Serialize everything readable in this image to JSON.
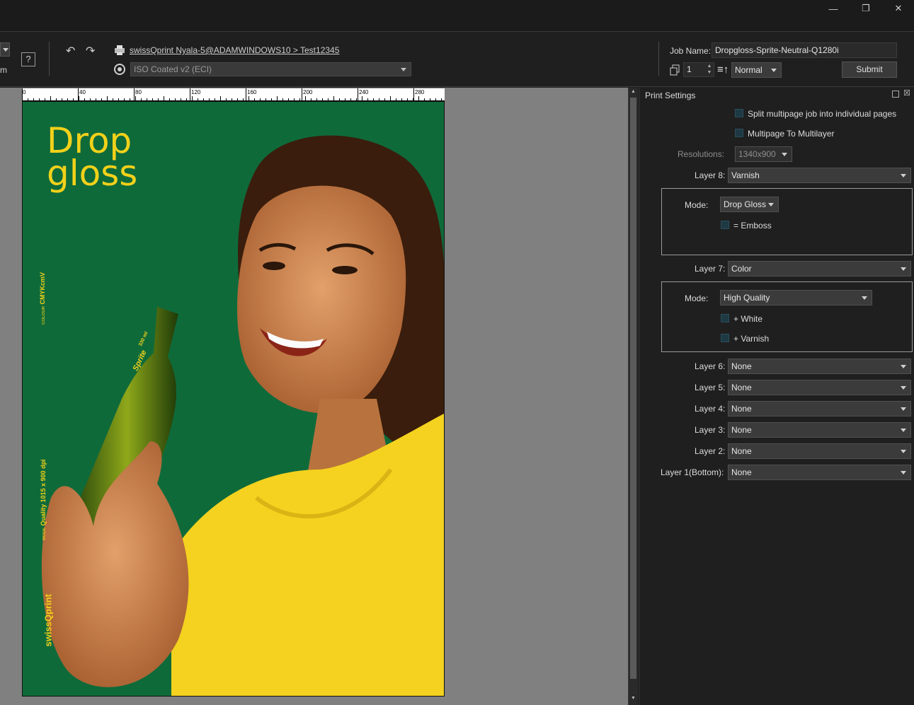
{
  "toolbar": {
    "left_text": "m",
    "printer_path": "swissQprint Nyala-5@ADAMWINDOWS10 > Test12345",
    "color_profile": "ISO Coated v2 (ECI)",
    "job_name_label": "Job Name:",
    "job_name_value": "Dropgloss-Sprite-Neutral-Q1280i",
    "copies": "1",
    "priority": "Normal",
    "submit_label": "Submit"
  },
  "ruler": {
    "ticks": [
      "0",
      "40",
      "80",
      "120",
      "160",
      "200",
      "240",
      "280"
    ]
  },
  "artwork": {
    "headline_line1": "Drop",
    "headline_line2": "gloss",
    "side_text_mode_label": "MODE",
    "side_text_mode_value": "Quality 1015 x 900 dpi",
    "side_text_colour_label": "COLOUR",
    "side_text_colour_value": "CMYKcmV",
    "brand_logo": "swissQprint",
    "bottle_label": "Sprite",
    "bottle_volume": "330 ml"
  },
  "panel": {
    "title": "Print Settings",
    "split_label": "Split multipage job into individual pages",
    "multilayer_label": "Multipage To Multilayer",
    "resolutions_label": "Resolutions:",
    "resolutions_value": "1340x900",
    "layers": [
      {
        "label": "Layer 8:",
        "value": "Varnish"
      },
      {
        "label": "Layer 7:",
        "value": "Color"
      },
      {
        "label": "Layer 6:",
        "value": "None"
      },
      {
        "label": "Layer 5:",
        "value": "None"
      },
      {
        "label": "Layer 4:",
        "value": "None"
      },
      {
        "label": "Layer 3:",
        "value": "None"
      },
      {
        "label": "Layer 2:",
        "value": "None"
      },
      {
        "label": "Layer 1(Bottom):",
        "value": "None"
      }
    ],
    "group8": {
      "mode_label": "Mode:",
      "mode_value": "Drop Gloss",
      "option1": "= Emboss"
    },
    "group7": {
      "mode_label": "Mode:",
      "mode_value": "High Quality",
      "option1": "+ White",
      "option2": "+ Varnish"
    }
  },
  "colors": {
    "artwork_green": "#0f6a3a",
    "headline_yellow": "#f2d11a",
    "shirt_yellow": "#f4d21f",
    "panel_bg": "#1f1f1f"
  }
}
